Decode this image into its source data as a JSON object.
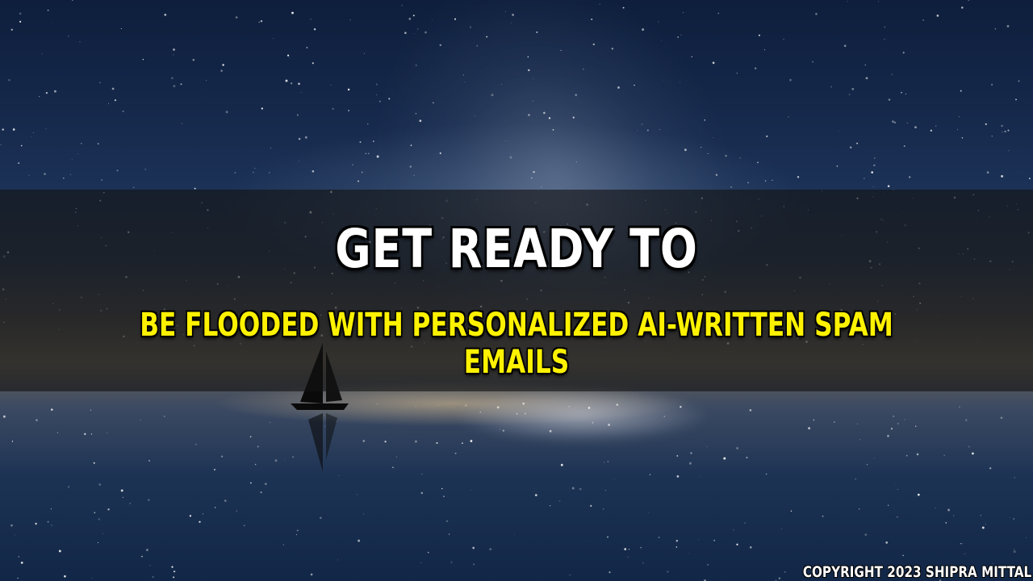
{
  "headline": "GET READY TO",
  "subline": "BE FLOODED WITH PERSONALIZED AI-WRITTEN SPAM EMAILS",
  "copyright": "COPYRIGHT 2023 SHIPRA MITTAL",
  "colors": {
    "headline": "#ffffff",
    "subline": "#fff200",
    "banner": "#141414",
    "sky": "#0e1e3c"
  },
  "icons": {
    "boat": "sailboat-icon"
  }
}
